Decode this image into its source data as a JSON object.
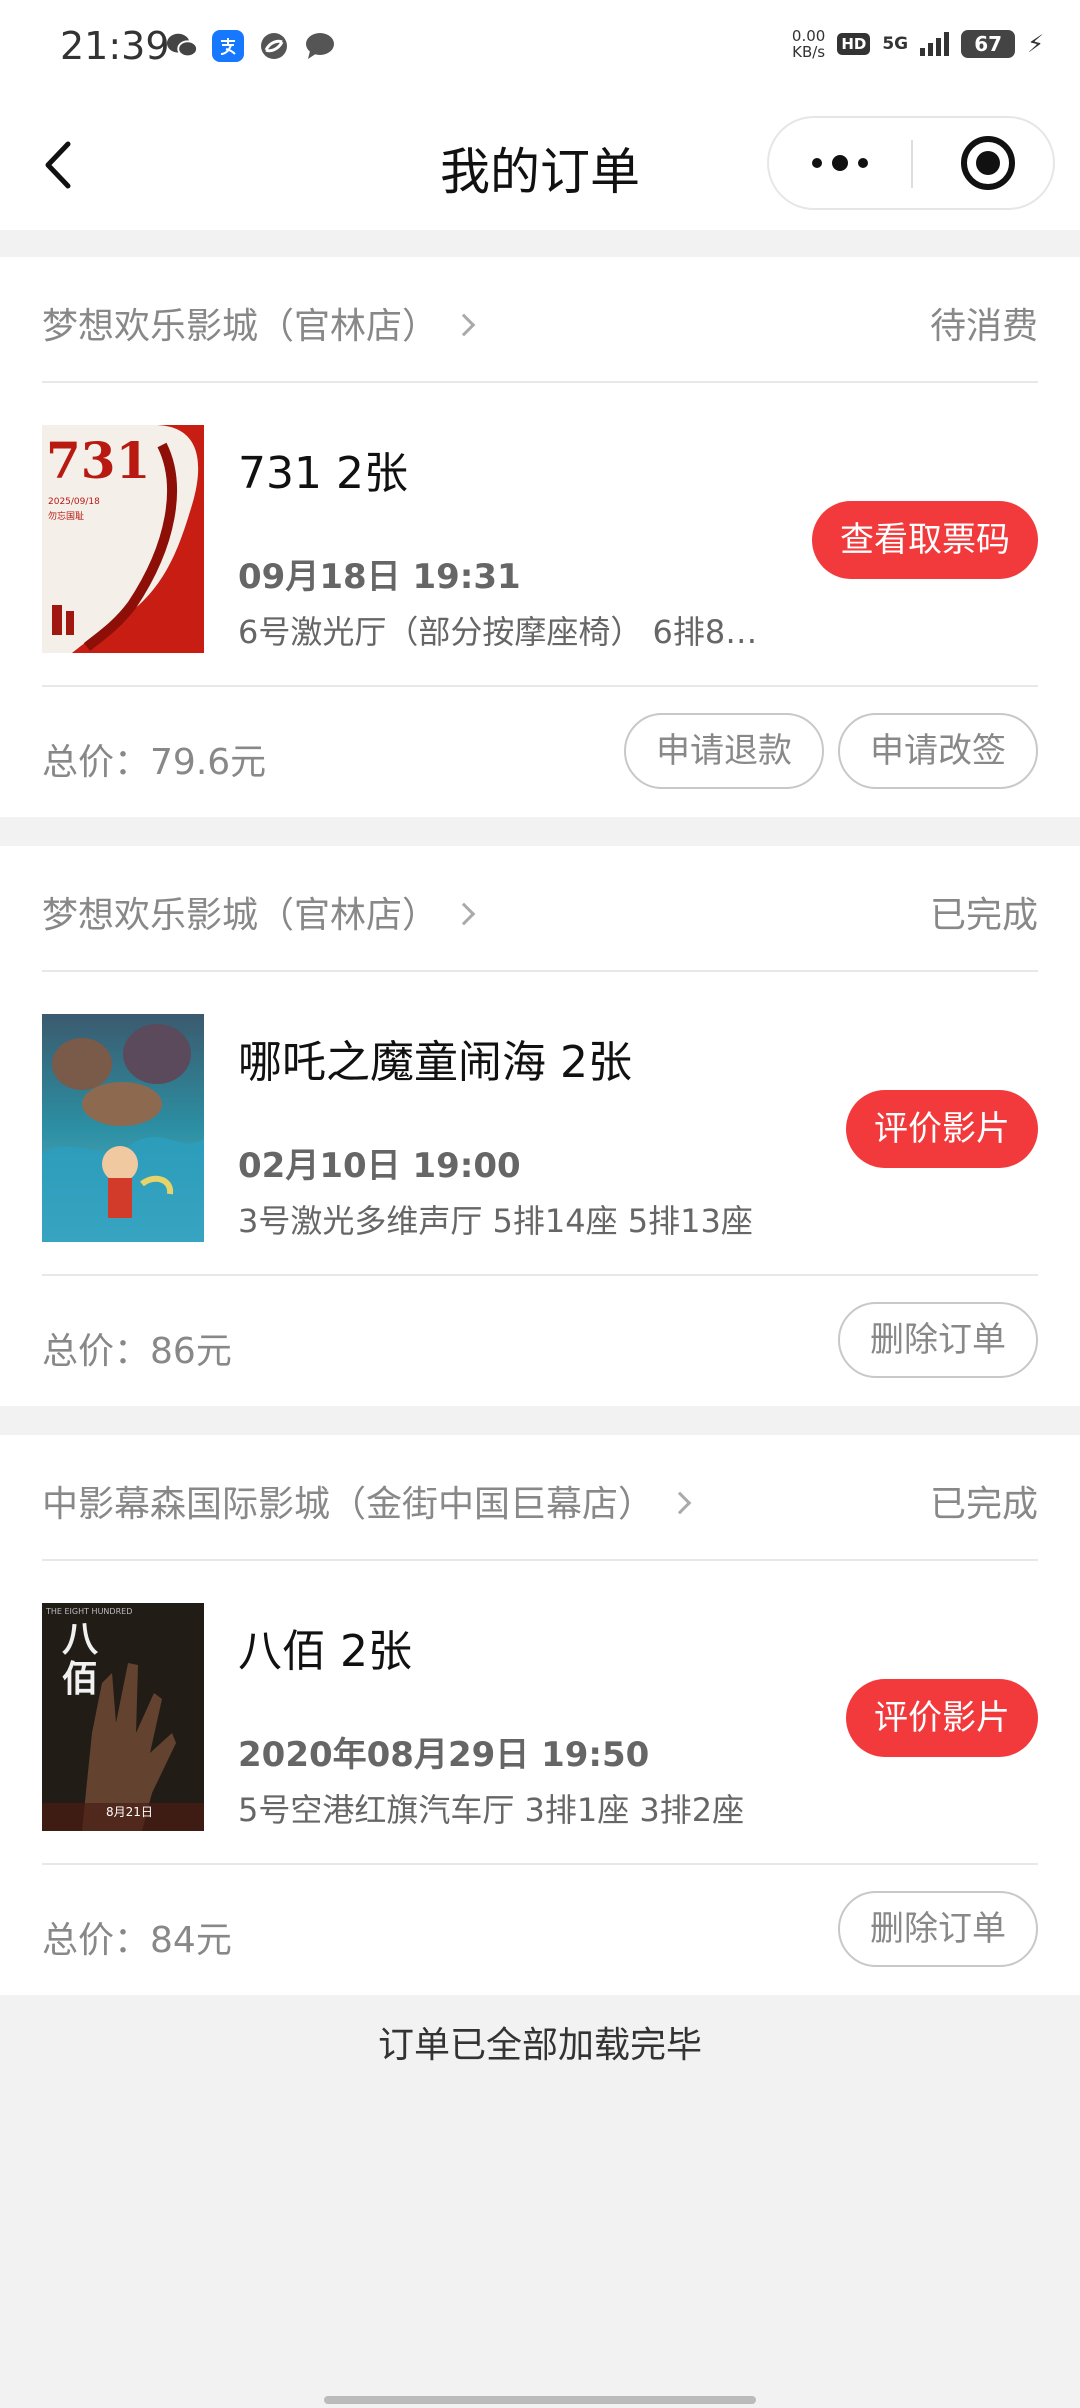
{
  "status_bar": {
    "time": "21:39",
    "net_speed_top": "0.00",
    "net_speed_unit": "KB/s",
    "hd": "HD",
    "network": "5G",
    "battery": "67"
  },
  "nav": {
    "title": "我的订单"
  },
  "orders": [
    {
      "cinema": "梦想欢乐影城（官林店）",
      "status": "待消费",
      "movie": "731 2张",
      "showtime": "09月18日 19:31",
      "hall": "6号激光厅（部分按摩座椅） 6排8…",
      "action": "查看取票码",
      "total_label": "总价：",
      "total_value": "79.6元",
      "buttons": [
        "申请退款",
        "申请改签"
      ],
      "poster_text": "731",
      "poster_date": "2025/09/18",
      "poster_tag": "勿忘国耻"
    },
    {
      "cinema": "梦想欢乐影城（官林店）",
      "status": "已完成",
      "movie": "哪吒之魔童闹海 2张",
      "showtime": "02月10日 19:00",
      "hall": "3号激光多维声厅 5排14座 5排13座",
      "action": "评价影片",
      "total_label": "总价：",
      "total_value": "86元",
      "buttons": [
        "删除订单"
      ]
    },
    {
      "cinema": "中影幕森国际影城（金街中国巨幕店）",
      "status": "已完成",
      "movie": "八佰 2张",
      "showtime": "2020年08月29日 19:50",
      "hall": "5号空港红旗汽车厅 3排1座 3排2座",
      "action": "评价影片",
      "total_label": "总价：",
      "total_value": "84元",
      "buttons": [
        "删除订单"
      ],
      "poster_text": "八佰",
      "poster_sub": "THE EIGHT HUNDRED",
      "poster_date": "8月21日"
    }
  ],
  "footer_note": "订单已全部加载完毕",
  "colors": {
    "accent": "#f23a3c",
    "background": "#f2f2f2"
  }
}
